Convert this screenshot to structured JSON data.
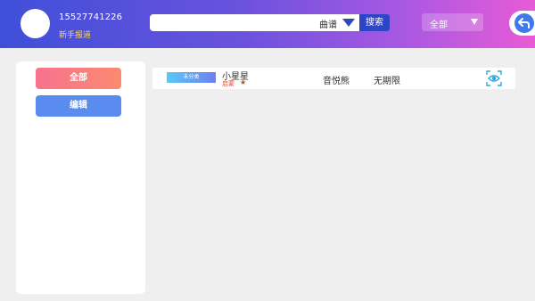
{
  "header": {
    "phone": "15527741226",
    "guide_link": "新手报道",
    "search": {
      "category": "曲谱",
      "button_label": "搜索",
      "value": ""
    },
    "filter": {
      "selected": "全部"
    }
  },
  "sidebar": {
    "all_label": "全部",
    "edit_label": "编辑"
  },
  "list": [
    {
      "category_tag": "未分类",
      "title": "小星星",
      "level": "启蒙",
      "publisher": "音悦熊",
      "validity": "无期限"
    }
  ],
  "colors": {
    "header_start": "#3f4fd9",
    "header_end": "#e85bd5",
    "search_button": "#2f45c7",
    "all_button": "#f8728f",
    "edit_button": "#5a8cf0",
    "level_text": "#d8513a",
    "guide_text": "#ffd94a"
  },
  "icons": [
    "avatar",
    "caret-down-icon",
    "back-arrow-icon",
    "star-icon",
    "eye-scan-icon"
  ]
}
